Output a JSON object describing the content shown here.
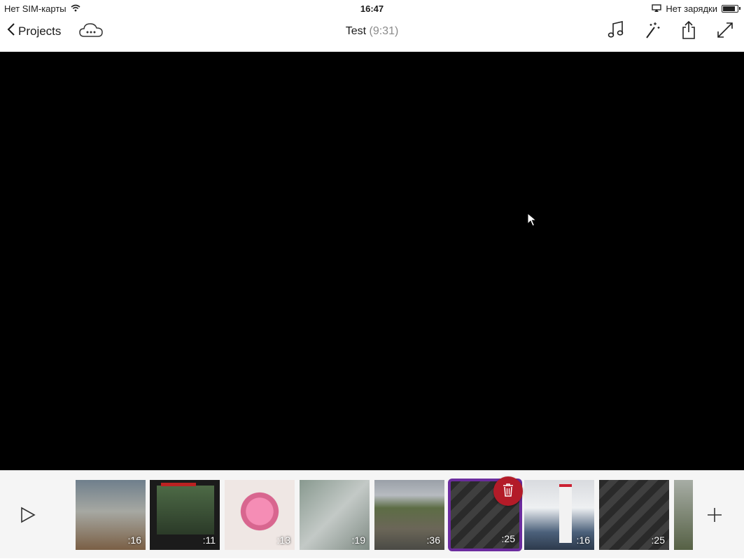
{
  "status_bar": {
    "carrier": "Нет SIM-карты",
    "time": "16:47",
    "charging": "Нет зарядки",
    "battery_level": 0.9
  },
  "nav": {
    "back_label": "Projects",
    "title": "Test",
    "duration": "(9:31)",
    "icons": [
      "back-chevron-icon",
      "cloud-icon",
      "music-note-icon",
      "magic-wand-icon",
      "share-icon",
      "fullscreen-icon"
    ]
  },
  "timeline": {
    "clips": [
      {
        "duration": ":16"
      },
      {
        "duration": ":11"
      },
      {
        "duration": ":13"
      },
      {
        "duration": ":19"
      },
      {
        "duration": ":36"
      },
      {
        "duration": ":25",
        "selected": true
      },
      {
        "duration": ":16"
      },
      {
        "duration": ":25"
      }
    ],
    "selected_color": "#6b2c9e",
    "delete_color": "#b31b28"
  }
}
